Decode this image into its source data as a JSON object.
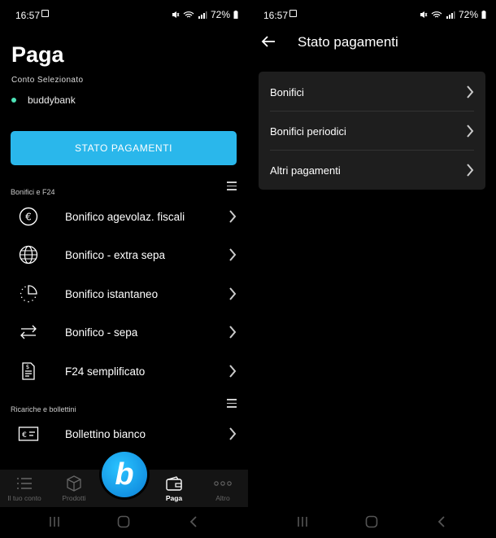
{
  "status": {
    "time": "16:57",
    "battery": "72%"
  },
  "left": {
    "title": "Paga",
    "account_label": "Conto Selezionato",
    "account_name": "buddybank",
    "cta_label": "STATO PAGAMENTI",
    "section1": "Bonifici e F24",
    "items1": [
      {
        "label": "Bonifico agevolaz. fiscali",
        "icon": "euro-circle-icon"
      },
      {
        "label": "Bonifico - extra sepa",
        "icon": "globe-icon"
      },
      {
        "label": "Bonifico istantaneo",
        "icon": "timer-icon"
      },
      {
        "label": "Bonifico - sepa",
        "icon": "transfer-arrows-icon"
      },
      {
        "label": "F24 semplificato",
        "icon": "document-icon"
      }
    ],
    "section2": "Ricariche e bollettini",
    "items2": [
      {
        "label": "Bollettino bianco",
        "icon": "bollettino-icon"
      }
    ],
    "tabs": [
      {
        "label": "Il tuo conto",
        "icon": "list-icon"
      },
      {
        "label": "Prodotti",
        "icon": "box-icon"
      },
      {
        "label": "Paga",
        "icon": "wallet-icon"
      },
      {
        "label": "Altro",
        "icon": "more-icon"
      }
    ],
    "fab_letter": "b"
  },
  "right": {
    "title": "Stato pagamenti",
    "items": [
      "Bonifici",
      "Bonifici periodici",
      "Altri pagamenti"
    ]
  },
  "colors": {
    "accent": "#2ab7eb",
    "account_dot": "#4de3b7",
    "card": "#1e1e1e"
  }
}
